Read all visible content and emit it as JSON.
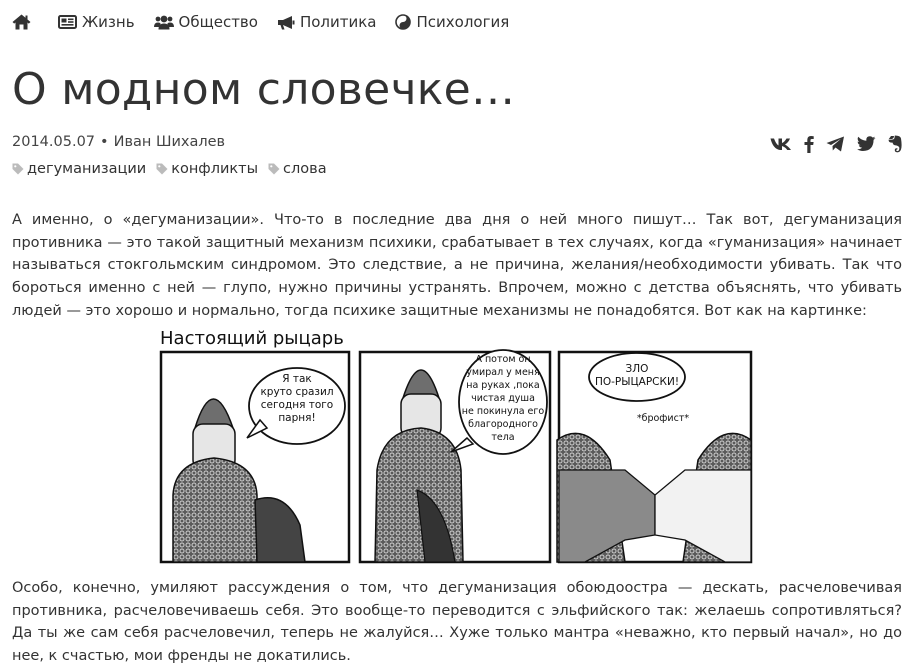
{
  "nav": {
    "home_icon": "home-icon",
    "items": [
      {
        "label": "Жизнь",
        "icon": "newspaper-icon"
      },
      {
        "label": "Общество",
        "icon": "users-icon"
      },
      {
        "label": "Политика",
        "icon": "bullhorn-icon"
      },
      {
        "label": "Психология",
        "icon": "yin-yang-icon"
      }
    ]
  },
  "article": {
    "title": "О модном словечке…",
    "date": "2014.05.07",
    "separator": "•",
    "author": "Иван Шихалев",
    "tags": [
      "дегуманизации",
      "конфликты",
      "слова"
    ],
    "share_icons": [
      "vk-icon",
      "facebook-icon",
      "telegram-icon",
      "twitter-icon",
      "evernote-icon"
    ],
    "paragraph1": "А именно, о «дегуманизации». Что-то в последние два дня о ней много пишут… Так вот, дегуманизация противника — это такой защитный механизм психики, срабатывает в тех случаях, когда «гуманизация» начинает называться стокгольмским синдромом. Это следствие, а не причина, желания/необходимости убивать. Так что бороться именно с ней — глупо, нужно причины устранять. Впрочем, можно с детства объяснять, что убивать людей — это хорошо и нормально, тогда психике защитные механизмы не понадобятся. Вот как на картинке:",
    "paragraph2": "Особо, конечно, умиляют рассуждения о том, что дегуманизация обоюдоостра — дескать, расчеловечивая противника, расчеловечиваешь себя. Это вообще-то переводится с эльфийского так: желаешь сопротивляться? Да ты же сам себя расчеловечил, теперь не жалуйся… Хуже только мантра «неважно, кто первый начал», но до нее, к счастью, мои френды не докатились."
  },
  "comic": {
    "title": "Настоящий рыцарь",
    "panel1_lines": [
      "Я так",
      "круто сразил",
      "сегодня того",
      "парня!"
    ],
    "panel2_lines": [
      "А потом он",
      "умирал у меня",
      "на руках ,пока",
      "чистая душа",
      "не покинула его",
      "благородного",
      "тела"
    ],
    "panel3_lines": [
      "ЗЛО",
      "ПО-РЫЦАРСКИ!"
    ],
    "panel3_sfx": "*брофист*"
  }
}
